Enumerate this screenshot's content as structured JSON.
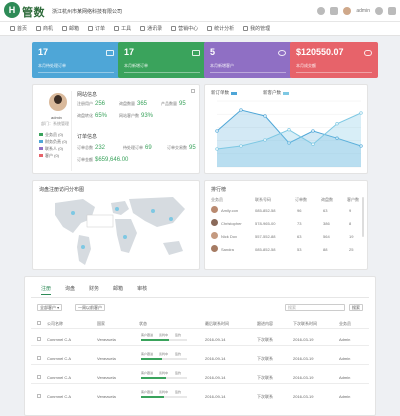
{
  "header": {
    "logo_mark": "H",
    "logo_text": "管数",
    "company": "浙江杭州市某网络科技有限公司",
    "user": "admin"
  },
  "nav": [
    {
      "label": "首页",
      "icon": "home-icon"
    },
    {
      "label": "商机",
      "icon": "opportunity-icon"
    },
    {
      "label": "邮箱",
      "icon": "mail-icon"
    },
    {
      "label": "订单",
      "icon": "order-icon"
    },
    {
      "label": "工具",
      "icon": "tool-icon"
    },
    {
      "label": "通讯录",
      "icon": "contacts-icon"
    },
    {
      "label": "营销中心",
      "icon": "marketing-icon"
    },
    {
      "label": "统计分析",
      "icon": "stats-icon"
    },
    {
      "label": "我的管理",
      "icon": "manage-icon"
    }
  ],
  "stats": [
    {
      "value": "17",
      "label": "本月待处理订单",
      "color": "#4ea6d7",
      "icon": "truck-icon"
    },
    {
      "value": "17",
      "label": "本月新增订单",
      "color": "#3aa35c",
      "icon": "folder-icon"
    },
    {
      "value": "5",
      "label": "本月新增客户",
      "color": "#8f6fc4",
      "icon": "user-icon"
    },
    {
      "value": "$120550.07",
      "label": "本月成交额",
      "color": "#e7636a",
      "icon": "cloud-icon"
    }
  ],
  "profile": {
    "name": "admin",
    "role": "部门：系统管理",
    "tags": [
      {
        "label": "业务员 (0)",
        "color": "#3aa35c"
      },
      {
        "label": "财务负责 (0)",
        "color": "#4ea6d7"
      },
      {
        "label": "联系人 (0)",
        "color": "#8f6fc4"
      },
      {
        "label": "客户 (0)",
        "color": "#e7636a"
      }
    ],
    "net_title": "网站信息",
    "net": [
      {
        "label": "注册用户",
        "value": "256"
      },
      {
        "label": "询盘数量",
        "value": "365"
      },
      {
        "label": "产品数量",
        "value": "95"
      },
      {
        "label": "询盘转化",
        "value": "65%"
      },
      {
        "label": "网站客户数",
        "value": "93%"
      }
    ],
    "order_title": "订单信息",
    "order": [
      {
        "label": "订单总数",
        "value": "232"
      },
      {
        "label": "待处理订单",
        "value": "69"
      },
      {
        "label": "订单交易数",
        "value": "95"
      },
      {
        "label": "订单金额",
        "value": "$659,646.00"
      }
    ]
  },
  "chart": {
    "legend_a": "新订单数",
    "legend_b": "新客户数",
    "color_a": "#4ea6d7",
    "color_b": "#7ec8e3"
  },
  "chart_data": {
    "type": "area",
    "x": [
      1,
      2,
      3,
      4,
      5,
      6,
      7
    ],
    "series": [
      {
        "name": "新订单数",
        "values": [
          60,
          95,
          85,
          40,
          60,
          48,
          35
        ]
      },
      {
        "name": "新客户数",
        "values": [
          30,
          35,
          45,
          62,
          38,
          72,
          90
        ]
      }
    ],
    "ylim": [
      0,
      110
    ],
    "grid": true
  },
  "map": {
    "title": "询盘注册访问分布图"
  },
  "leaderboard": {
    "title": "排行榜",
    "headers": [
      "业务员",
      "联系号码",
      "订单数",
      "询盘数",
      "客户数"
    ],
    "rows": [
      {
        "name": "Amily.con",
        "phone": "085-852-58",
        "orders": "96",
        "inq": "63",
        "cust": "9"
      },
      {
        "name": "Christopher",
        "phone": "578-965-00",
        "orders": "73",
        "inq": "386",
        "cust": "8"
      },
      {
        "name": "Nick Dox",
        "phone": "557-552-88",
        "orders": "63",
        "inq": "564",
        "cust": "19"
      },
      {
        "name": "Sandra",
        "phone": "085-852-58",
        "orders": "53",
        "inq": "88",
        "cust": "25"
      }
    ]
  },
  "bottom": {
    "tabs": [
      "注册",
      "询盘",
      "财务",
      "邮箱",
      "审核"
    ],
    "btn_all": "全部客户",
    "btn_period": "一周以前客户",
    "search_placeholder": "搜索",
    "search_btn": "搜索",
    "headers": [
      "公司名称",
      "国家",
      "状态",
      "最后联系时间",
      "跟进内容",
      "下次联系时间",
      "业务员"
    ],
    "rows": [
      {
        "company": "Conrnnel C.A",
        "country": "Venezuela",
        "s1": "客户跟进",
        "s2": "谈判中",
        "s3": "签约",
        "last": "2016-09-14",
        "follow": "下次联系",
        "next": "2016-03-19",
        "agent": "Admin",
        "progress": 0.6
      },
      {
        "company": "Conrnnel C.A",
        "country": "Venezuela",
        "s1": "客户跟进",
        "s2": "谈判中",
        "s3": "签约",
        "last": "2016-09-14",
        "follow": "下次联系",
        "next": "2016-03-19",
        "agent": "Admin",
        "progress": 0.45
      },
      {
        "company": "Conrnnel C.A",
        "country": "Venezuela",
        "s1": "客户跟进",
        "s2": "谈判中",
        "s3": "签约",
        "last": "2016-09-14",
        "follow": "下次联系",
        "next": "2016-03-19",
        "agent": "Admin",
        "progress": 0.55
      },
      {
        "company": "Conrnnel C.A",
        "country": "Venezuela",
        "s1": "客户跟进",
        "s2": "谈判中",
        "s3": "签约",
        "last": "2016-09-14",
        "follow": "下次联系",
        "next": "2016-03-19",
        "agent": "Admin",
        "progress": 0.5
      }
    ]
  }
}
